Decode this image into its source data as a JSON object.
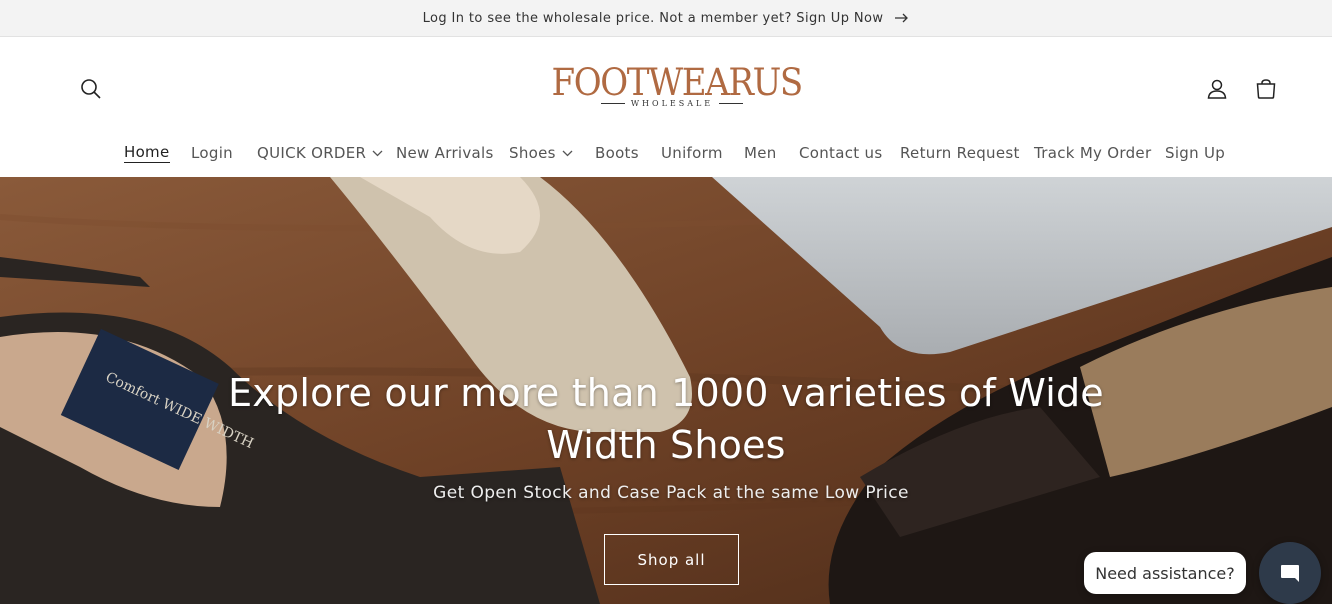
{
  "announcement": {
    "text": "Log In to see the wholesale price. Not a member yet? Sign Up Now",
    "arrow_icon": "arrow-right-icon"
  },
  "header": {
    "logo_word": "FOOTWEARUS",
    "logo_sub": "WHOLESALE",
    "brand_color": "#b06a42",
    "icons": {
      "search": "search-icon",
      "account": "account-icon",
      "cart": "cart-icon"
    }
  },
  "nav": {
    "items": [
      {
        "label": "Home",
        "active": true
      },
      {
        "label": "Login"
      },
      {
        "label": "QUICK ORDER",
        "dropdown": true
      },
      {
        "label": "New Arrivals"
      },
      {
        "label": "Shoes",
        "dropdown": true
      },
      {
        "label": "Boots"
      },
      {
        "label": "Uniform"
      },
      {
        "label": "Men"
      },
      {
        "label": "Contact us"
      },
      {
        "label": "Return Request"
      },
      {
        "label": "Track My Order"
      },
      {
        "label": "Sign Up"
      }
    ]
  },
  "hero": {
    "title": "Explore our more than 1000 varieties of Wide Width Shoes",
    "subtitle": "Get Open Stock and Case Pack at the same Low Price",
    "cta_label": "Shop all",
    "label_text": "Comfort WIDE WIDTH"
  },
  "chat": {
    "assist_label": "Need assistance?",
    "chat_icon": "chat-bubble-icon",
    "chat_color": "#2e3a4a"
  }
}
